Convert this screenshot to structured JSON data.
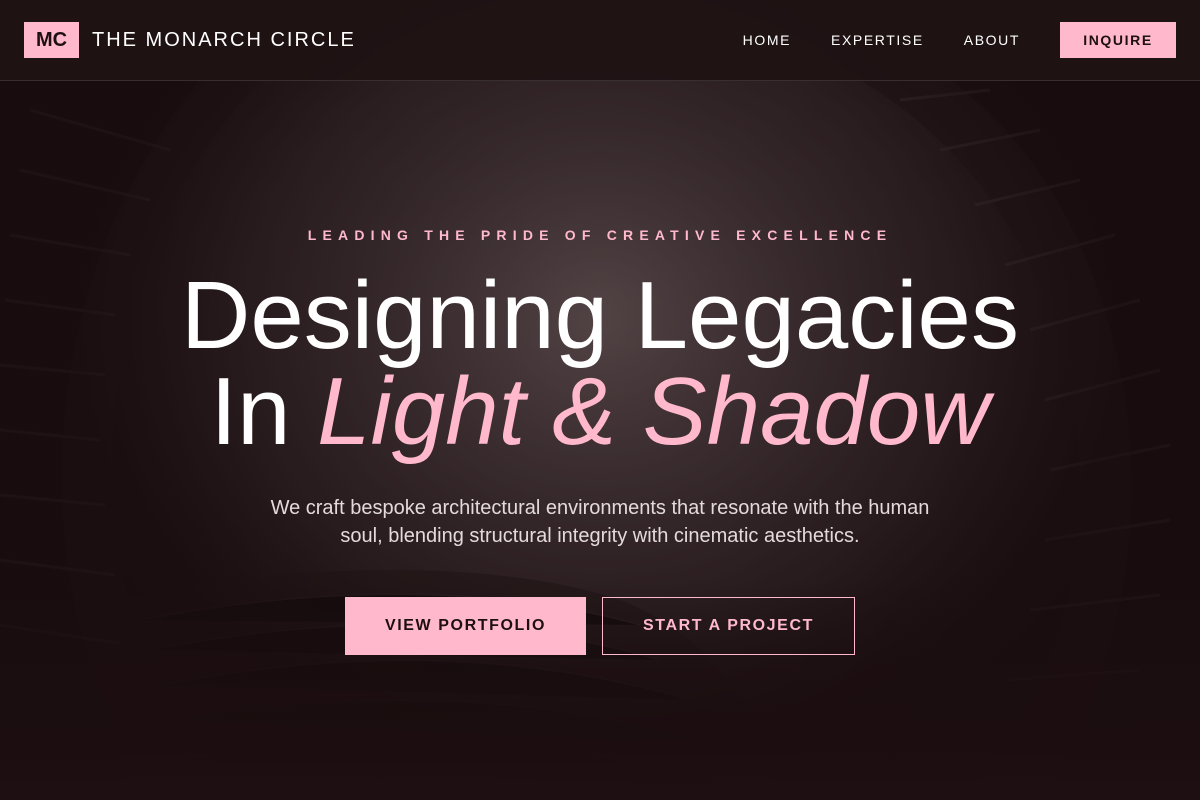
{
  "header": {
    "logo_mark": "MC",
    "brand_name": "THE MONARCH CIRCLE",
    "nav": [
      {
        "label": "HOME"
      },
      {
        "label": "EXPERTISE"
      },
      {
        "label": "ABOUT"
      }
    ],
    "cta_label": "INQUIRE"
  },
  "hero": {
    "eyebrow": "LEADING THE PRIDE OF CREATIVE EXCELLENCE",
    "headline_line1": "Designing Legacies",
    "headline_line2_prefix": "In",
    "headline_line2_accent": "Light & Shadow",
    "subtitle": "We craft bespoke architectural environments that resonate with the human soul, blending structural integrity with cinematic aesthetics.",
    "primary_button": "VIEW PORTFOLIO",
    "secondary_button": "START A PROJECT"
  },
  "colors": {
    "accent": "#ffb8cc",
    "background": "#1f1214",
    "text": "#ffffff"
  }
}
